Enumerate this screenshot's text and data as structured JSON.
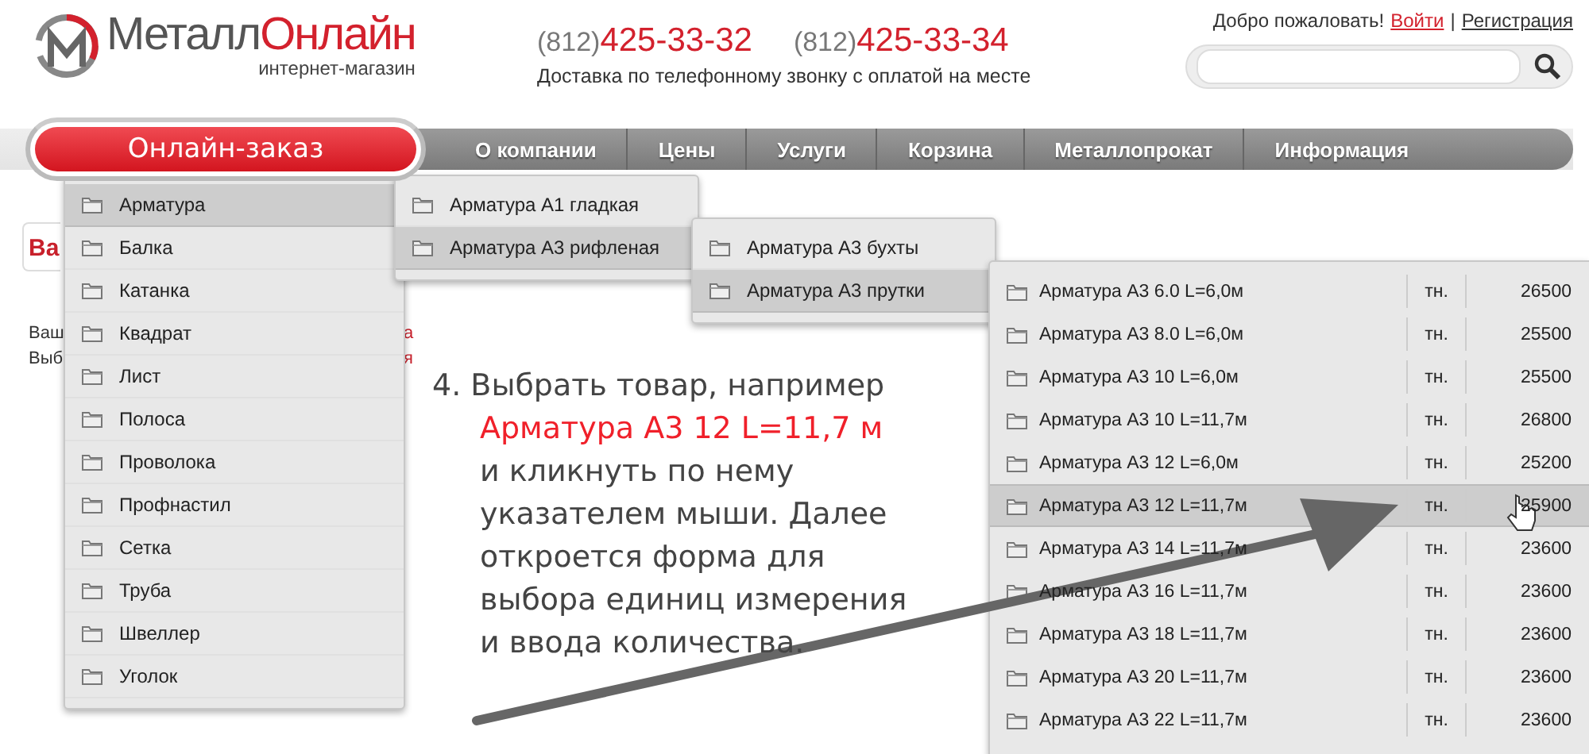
{
  "logo": {
    "name_dark": "Металл",
    "name_red": "Онлайн",
    "tagline": "интернет-магазин"
  },
  "phones": [
    {
      "code": "(812)",
      "number": "425-33-32"
    },
    {
      "code": "(812)",
      "number": "425-33-34"
    }
  ],
  "delivery_note": "Доставка по телефонному звонку с оплатой на месте",
  "user_links": {
    "greeting": "Добро пожаловать!",
    "login": "Войти",
    "separator": "|",
    "register": "Регистрация"
  },
  "nav": {
    "order_button": "Онлайн-заказ",
    "items": [
      "О компании",
      "Цены",
      "Услуги",
      "Корзина",
      "Металлопрокат",
      "Информация"
    ]
  },
  "covered_page": {
    "heading": "Ва",
    "lines_left": [
      "Ваш",
      "Выб"
    ],
    "lines_right": [
      "а",
      "я"
    ]
  },
  "menus": [
    {
      "items": [
        {
          "label": "Арматура",
          "selected": true
        },
        {
          "label": "Балка",
          "selected": false
        },
        {
          "label": "Катанка",
          "selected": false
        },
        {
          "label": "Квадрат",
          "selected": false
        },
        {
          "label": "Лист",
          "selected": false
        },
        {
          "label": "Полоса",
          "selected": false
        },
        {
          "label": "Проволока",
          "selected": false
        },
        {
          "label": "Профнастил",
          "selected": false
        },
        {
          "label": "Сетка",
          "selected": false
        },
        {
          "label": "Труба",
          "selected": false
        },
        {
          "label": "Швеллер",
          "selected": false
        },
        {
          "label": "Уголок",
          "selected": false
        }
      ]
    },
    {
      "items": [
        {
          "label": "Арматура А1 гладкая",
          "selected": false
        },
        {
          "label": "Арматура А3 рифленая",
          "selected": true
        }
      ]
    },
    {
      "items": [
        {
          "label": "Арматура А3 бухты",
          "selected": false
        },
        {
          "label": "Арматура А3 прутки",
          "selected": true
        }
      ]
    }
  ],
  "products": {
    "rows": [
      {
        "name": "Арматура А3 6.0 L=6,0м",
        "unit": "тн.",
        "price": "26500",
        "selected": false
      },
      {
        "name": "Арматура А3 8.0 L=6,0м",
        "unit": "тн.",
        "price": "25500",
        "selected": false
      },
      {
        "name": "Арматура А3 10 L=6,0м",
        "unit": "тн.",
        "price": "25500",
        "selected": false
      },
      {
        "name": "Арматура А3 10 L=11,7м",
        "unit": "тн.",
        "price": "26800",
        "selected": false
      },
      {
        "name": "Арматура А3 12 L=6,0м",
        "unit": "тн.",
        "price": "25200",
        "selected": false
      },
      {
        "name": "Арматура А3 12 L=11,7м",
        "unit": "тн.",
        "price": "25900",
        "selected": true
      },
      {
        "name": "Арматура А3 14 L=11,7м",
        "unit": "тн.",
        "price": "23600",
        "selected": false
      },
      {
        "name": "Арматура А3 16 L=11,7м",
        "unit": "тн.",
        "price": "23600",
        "selected": false
      },
      {
        "name": "Арматура А3 18 L=11,7м",
        "unit": "тн.",
        "price": "23600",
        "selected": false
      },
      {
        "name": "Арматура А3 20 L=11,7м",
        "unit": "тн.",
        "price": "23600",
        "selected": false
      },
      {
        "name": "Арматура А3 22 L=11,7м",
        "unit": "тн.",
        "price": "23600",
        "selected": false
      }
    ]
  },
  "instruction": {
    "lines": [
      {
        "text": "4. Выбрать товар, например",
        "kind": "lead"
      },
      {
        "text": "Арматура А3 12 L=11,7 м",
        "kind": "highlight"
      },
      {
        "text": "и кликнуть по нему",
        "kind": "plain"
      },
      {
        "text": "указателем мыши. Далее",
        "kind": "plain"
      },
      {
        "text": "откроется форма для",
        "kind": "plain"
      },
      {
        "text": "выбора единиц измерения",
        "kind": "plain"
      },
      {
        "text": "и ввода количества.",
        "kind": "plain"
      }
    ]
  }
}
